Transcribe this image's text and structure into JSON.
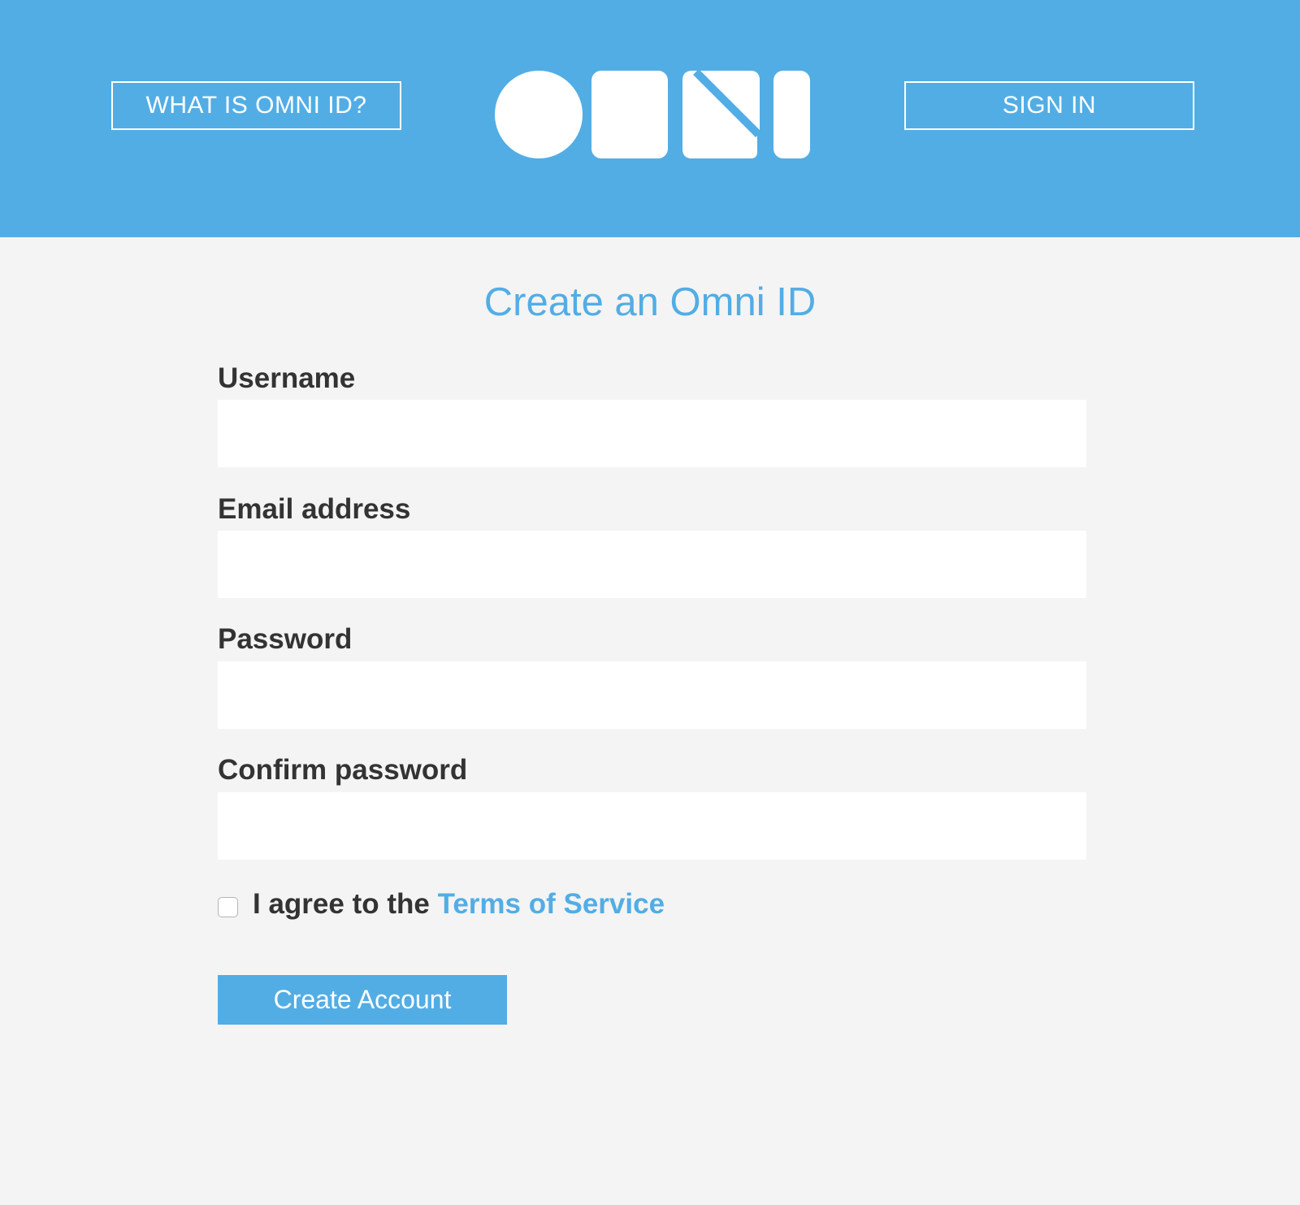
{
  "theme": {
    "accent": "#52ade5",
    "background": "#f4f4f4",
    "text": "#333333",
    "input_background": "#ffffff"
  },
  "header": {
    "what_is_label": "WHAT IS OMNI ID?",
    "sign_in_label": "SIGN IN",
    "logo_text": "OMNI"
  },
  "form": {
    "title": "Create an Omni ID",
    "fields": [
      {
        "label": "Username",
        "value": "",
        "placeholder": ""
      },
      {
        "label": "Email address",
        "value": "",
        "placeholder": ""
      },
      {
        "label": "Password",
        "value": "",
        "placeholder": ""
      },
      {
        "label": "Confirm password",
        "value": "",
        "placeholder": ""
      }
    ],
    "terms": {
      "prefix": "I agree to the ",
      "link": "Terms of Service",
      "checked": false
    },
    "submit_label": "Create Account"
  }
}
